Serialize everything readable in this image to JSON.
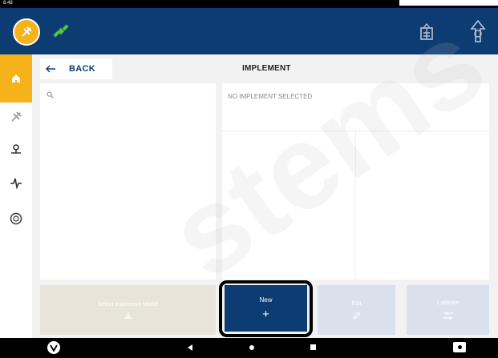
{
  "status_bar": {
    "time": "8:48"
  },
  "header": {
    "logo_icon": "brand-logo-icon",
    "gps_icon": "gps-satellite-icon",
    "implement_icon": "implement-icon",
    "tractor_icon": "tractor-icon"
  },
  "sidebar": {
    "items": [
      {
        "name": "home",
        "icon": "home-icon",
        "active": true
      },
      {
        "name": "guidance",
        "icon": "guidance-icon",
        "active": false
      },
      {
        "name": "steering",
        "icon": "steering-icon",
        "active": false
      },
      {
        "name": "diagnostics",
        "icon": "pulse-icon",
        "active": false
      },
      {
        "name": "settings",
        "icon": "dial-icon",
        "active": false
      }
    ]
  },
  "toolbar": {
    "back_label": "BACK",
    "title": "IMPLEMENT"
  },
  "left_panel": {
    "search_icon": "search-icon"
  },
  "right_panel": {
    "status_text": "NO IMPLEMENT SELECTED"
  },
  "actions": {
    "select_label": "Select Implement Model",
    "new_label": "New",
    "new_symbol": "+",
    "edit_label": "Edit",
    "calibrate_label": "Calibrate"
  },
  "watermark": {
    "text": "stems"
  },
  "colors": {
    "header_blue": "#0d3c73",
    "accent_yellow": "#f5b21b",
    "panel_white": "#ffffff",
    "background": "#f2f2f2"
  }
}
